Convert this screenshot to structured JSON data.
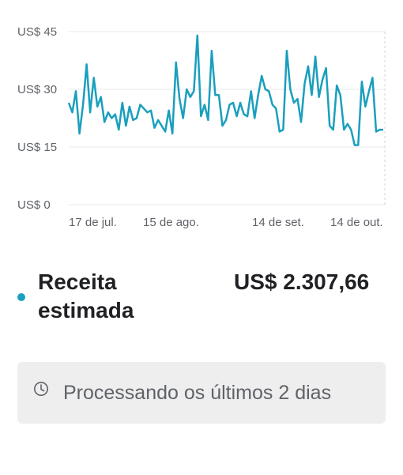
{
  "chart_data": {
    "type": "line",
    "x_tick_labels": [
      "17 de jul.",
      "15 de ago.",
      "14 de set.",
      "14 de out."
    ],
    "y_tick_labels": [
      "US$ 45",
      "US$ 30",
      "US$ 15",
      "US$ 0"
    ],
    "y_ticks": [
      45,
      30,
      15,
      0
    ],
    "ylim": [
      0,
      45
    ],
    "grid": true,
    "color": "#1a9fbd",
    "series": [
      {
        "values": [
          26.5,
          24,
          29.5,
          18.5,
          26,
          36.5,
          24,
          33,
          25.5,
          28,
          21.5,
          24,
          22.5,
          23.5,
          19.5,
          26.5,
          20.5,
          25.5,
          22,
          22.5,
          26,
          25,
          24,
          24.5,
          20,
          22,
          20.5,
          19,
          24.5,
          18.5,
          37,
          27.5,
          22.5,
          30,
          28,
          29.5,
          44,
          23,
          26,
          22,
          40,
          28.5,
          28.5,
          20.5,
          22,
          26,
          26.5,
          23,
          26.5,
          23.5,
          23,
          29.5,
          22.5,
          28.5,
          33.5,
          30,
          29.5,
          26,
          25,
          19,
          19.5,
          40,
          30,
          26.5,
          27.5,
          21.5,
          31.5,
          36,
          28.5,
          38.5,
          28,
          32.5,
          35.5,
          20.5,
          19.5,
          31,
          28.5,
          19.5,
          21,
          19.5,
          15.5,
          15.5,
          32,
          25.5,
          29.5,
          33,
          19,
          19.5,
          19.5
        ]
      }
    ]
  },
  "metric": {
    "label": "Receita estimada",
    "value": "US$ 2.307,66",
    "dot_color": "#1a9fbd"
  },
  "status": {
    "icon": "clock-icon",
    "text": "Processando os últimos 2 dias"
  }
}
